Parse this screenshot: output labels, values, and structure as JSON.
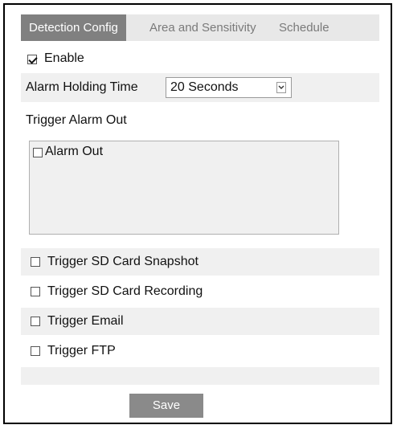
{
  "tabs": [
    {
      "label": "Detection Config",
      "active": true
    },
    {
      "label": "Area and Sensitivity",
      "active": false
    },
    {
      "label": "Schedule",
      "active": false
    }
  ],
  "enable": {
    "label": "Enable",
    "checked": true
  },
  "alarm_holding": {
    "label": "Alarm Holding Time",
    "selected": "20 Seconds"
  },
  "trigger_alarm_out": {
    "heading": "Trigger Alarm Out",
    "items": [
      {
        "label": "Alarm Out",
        "checked": false
      }
    ]
  },
  "triggers": [
    {
      "label": "Trigger SD Card Snapshot",
      "checked": false
    },
    {
      "label": "Trigger SD Card Recording",
      "checked": false
    },
    {
      "label": "Trigger Email",
      "checked": false
    },
    {
      "label": "Trigger FTP",
      "checked": false
    }
  ],
  "save_label": "Save",
  "colors": {
    "active_tab": "#808080",
    "tab_bar": "#e8e8e8",
    "row_shade": "#f0f0f0",
    "button": "#8a8a8a"
  }
}
